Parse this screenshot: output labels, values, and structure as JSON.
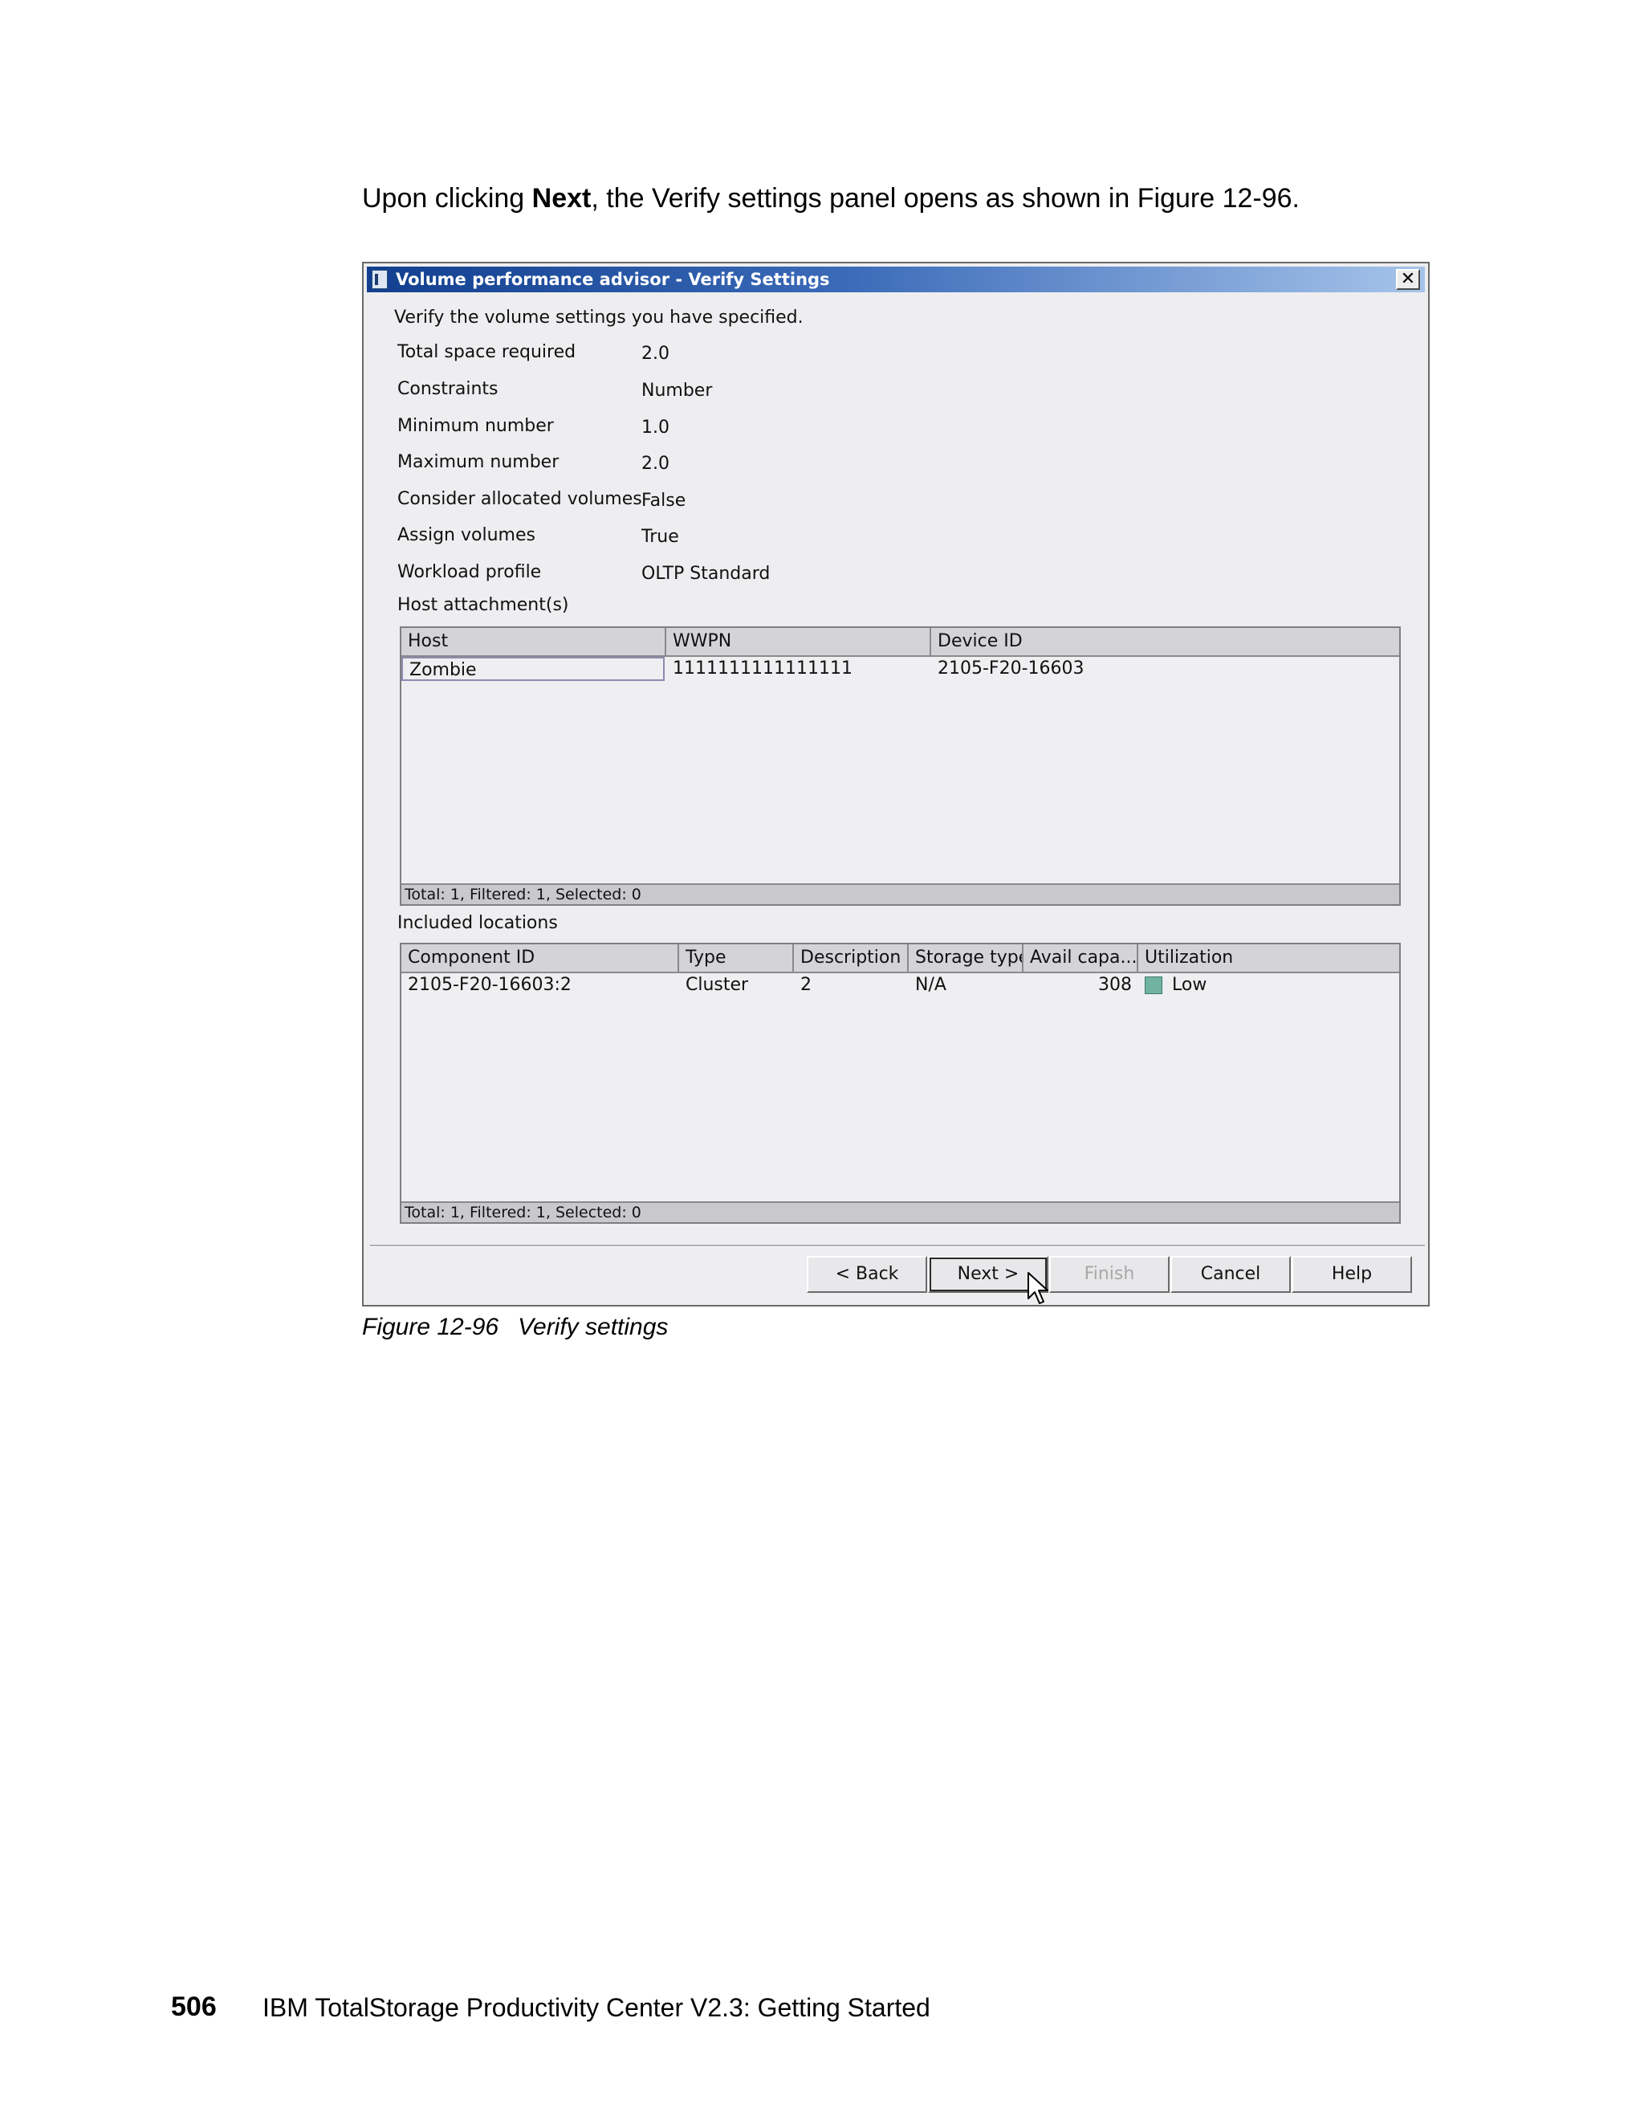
{
  "intro": {
    "before": "Upon clicking ",
    "bold": "Next",
    "after": ", the Verify settings panel opens as shown in Figure 12-96."
  },
  "dialog": {
    "title": "Volume performance advisor - Verify Settings",
    "close": "✕",
    "instruction": "Verify the volume settings you have specified.",
    "properties": [
      {
        "label": "Total space required",
        "value": "2.0"
      },
      {
        "label": "Constraints",
        "value": "Number"
      },
      {
        "label": "Minimum number",
        "value": "1.0"
      },
      {
        "label": "Maximum number",
        "value": "2.0"
      },
      {
        "label": "Consider allocated volumes",
        "value": "False"
      },
      {
        "label": "Assign volumes",
        "value": "True"
      },
      {
        "label": "Workload profile",
        "value": "OLTP Standard"
      }
    ],
    "host_table": {
      "heading": "Host attachment(s)",
      "columns": [
        "Host",
        "WWPN",
        "Device ID"
      ],
      "rows": [
        [
          "Zombie",
          "1111111111111111",
          "2105-F20-16603"
        ]
      ],
      "footer": "Total: 1, Filtered: 1, Selected: 0"
    },
    "locations_table": {
      "heading": "Included locations",
      "columns": [
        "Component ID",
        "Type",
        "Description",
        "Storage type",
        "Avail capa...",
        "Utilization"
      ],
      "rows": [
        [
          "2105-F20-16603:2",
          "Cluster",
          "2",
          "N/A",
          "308",
          "Low"
        ]
      ],
      "footer": "Total: 1, Filtered: 1, Selected: 0",
      "utilization_color": "#6fb3a0"
    },
    "buttons": {
      "back": "< Back",
      "next": "Next >",
      "finish": "Finish",
      "cancel": "Cancel",
      "help": "Help"
    }
  },
  "caption": {
    "number": "Figure 12-96",
    "title": "Verify settings"
  },
  "footer": {
    "page": "506",
    "title": "IBM TotalStorage Productivity Center V2.3: Getting Started"
  }
}
